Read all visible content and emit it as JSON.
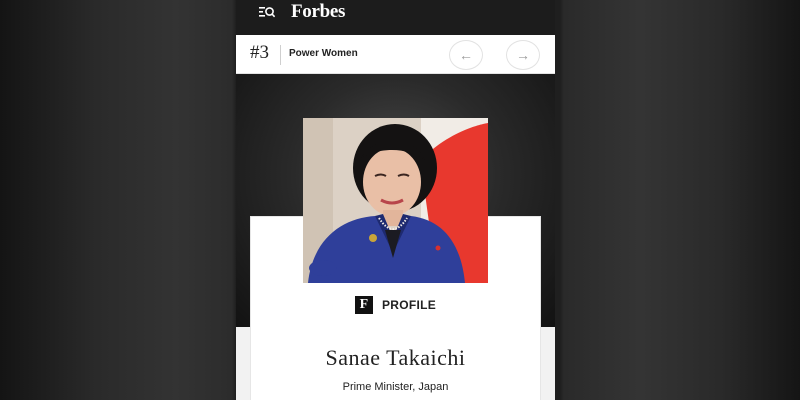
{
  "header": {
    "logo": "Forbes",
    "icon": "search-menu-icon"
  },
  "list": {
    "rank": "#3",
    "name": "Power Women",
    "prev_icon": "←",
    "next_icon": "→"
  },
  "profile": {
    "badge_letter": "F",
    "label": "PROFILE",
    "name": "Sanae Takaichi",
    "title": "Prime Minister, Japan"
  },
  "colors": {
    "topbar": "#1c1c1c",
    "flag_red": "#e8382e"
  }
}
